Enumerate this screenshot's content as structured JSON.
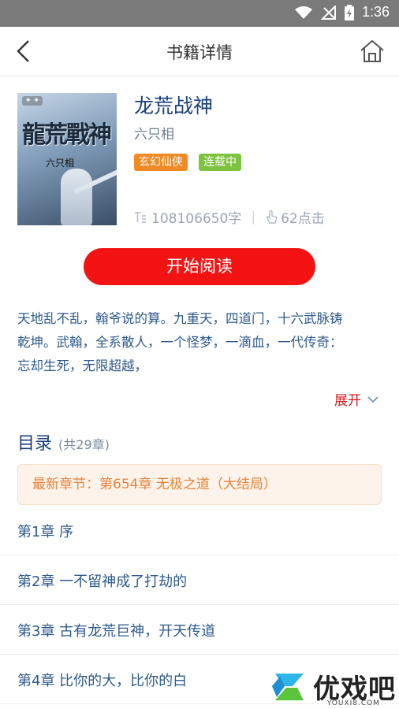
{
  "status_bar": {
    "time": "1:36",
    "icons": [
      "wifi-icon",
      "no-signal-icon",
      "battery-icon"
    ]
  },
  "nav": {
    "title": "书籍详情",
    "back_icon": "chevron-left-icon",
    "home_icon": "home-icon"
  },
  "book": {
    "cover_title": "龍荒戰神",
    "cover_author": "六只相",
    "title": "龙荒战神",
    "author": "六只相",
    "tags": [
      "玄幻仙侠",
      "连载中"
    ],
    "word_count": "108106650字",
    "clicks": "62点击"
  },
  "actions": {
    "read_label": "开始阅读",
    "expand_label": "展开"
  },
  "description": [
    "天地乱不乱，翰爷说的算。九重天，四道门，十六武脉铸",
    "乾坤。武翰，全系散人，一个怪梦，一滴血，一代传奇：",
    "忘却生死，无限超越，"
  ],
  "toc": {
    "title": "目录",
    "count": "(共29章)",
    "latest": "最新章节：第654章 无极之道（大结局）",
    "chapters": [
      "第1章 序",
      "第2章 一不留神成了打劫的",
      "第3章 古有龙荒巨神，开天传道",
      "第4章 比你的大，比你的白"
    ]
  },
  "watermark": {
    "text": "优戏吧",
    "sub": "YOUXI8.COM"
  },
  "colors": {
    "accent_red": "#f31313",
    "title_blue": "#1a3f7a",
    "text_blue": "#2e5a8c",
    "tag_orange": "#f08a24",
    "tag_green": "#7ec33f",
    "latest_bg": "#fdf3ea"
  }
}
